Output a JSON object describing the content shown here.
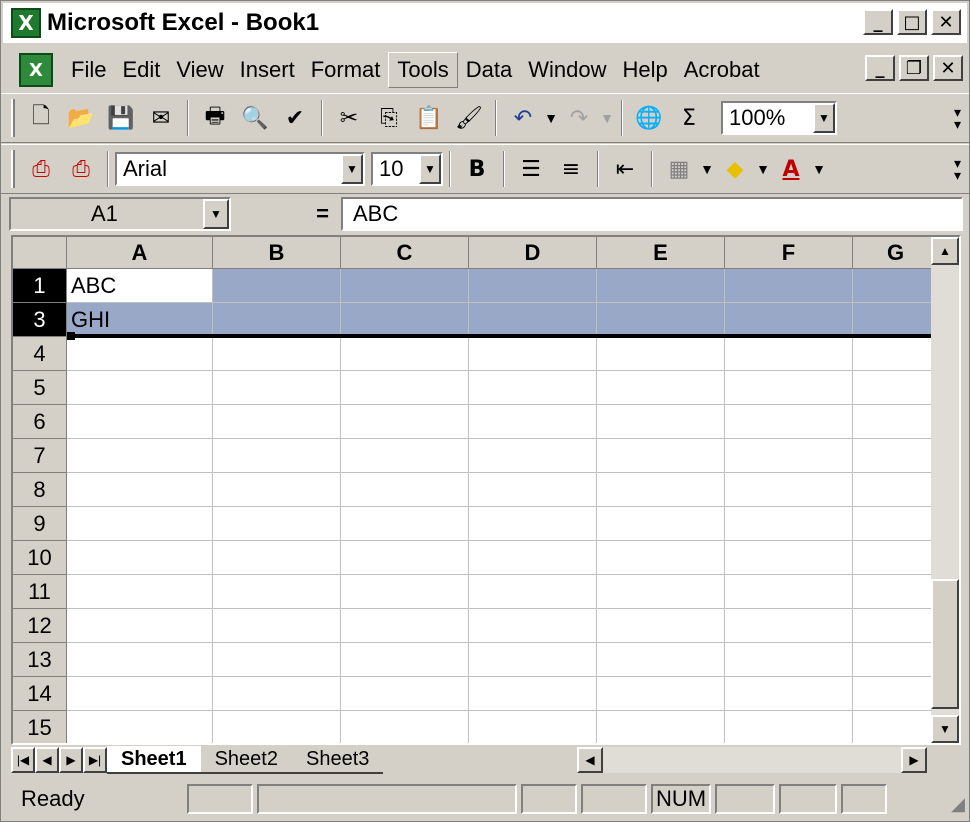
{
  "window": {
    "title": "Microsoft Excel - Book1"
  },
  "menu": [
    "File",
    "Edit",
    "View",
    "Insert",
    "Format",
    "Tools",
    "Data",
    "Window",
    "Help",
    "Acrobat"
  ],
  "toolbar": {
    "zoom": "100%",
    "font_name": "Arial",
    "font_size": "10",
    "bold_label": "B",
    "sum_label": "Σ",
    "font_color_label": "A"
  },
  "formula_bar": {
    "name_box": "A1",
    "equals": "=",
    "content": "ABC"
  },
  "grid": {
    "columns": [
      "A",
      "B",
      "C",
      "D",
      "E",
      "F",
      "G"
    ],
    "rows": [
      {
        "label": "1",
        "A": "ABC"
      },
      {
        "label": "3",
        "A": "GHI"
      },
      {
        "label": "4"
      },
      {
        "label": "5"
      },
      {
        "label": "6"
      },
      {
        "label": "7"
      },
      {
        "label": "8"
      },
      {
        "label": "9"
      },
      {
        "label": "10"
      },
      {
        "label": "11"
      },
      {
        "label": "12"
      },
      {
        "label": "13"
      },
      {
        "label": "14"
      },
      {
        "label": "15"
      }
    ]
  },
  "sheets": [
    "Sheet1",
    "Sheet2",
    "Sheet3"
  ],
  "status": {
    "text": "Ready",
    "num": "NUM"
  },
  "colors": {
    "selection": "#9aa8c8",
    "window": "#d4d0c8"
  }
}
